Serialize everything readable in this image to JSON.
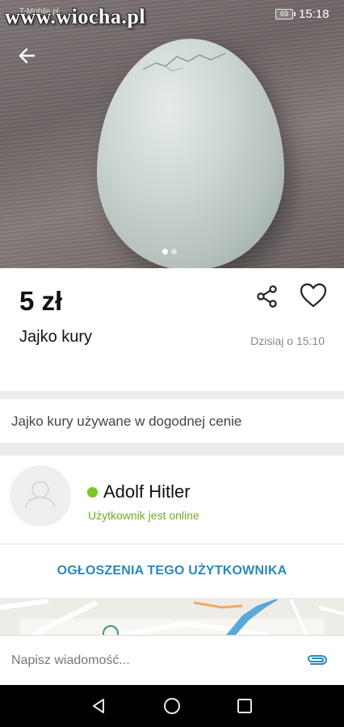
{
  "status_bar": {
    "carrier": "T-Mobile.pl",
    "battery": "69",
    "time": "15:18"
  },
  "watermark": "www.wiocha.pl",
  "gallery": {
    "image_count": 2,
    "active_index": 0
  },
  "listing": {
    "price": "5 zł",
    "title": "Jajko kury",
    "date": "Dzisiaj o 15:10",
    "description": "Jajko kury używane w dogodnej cenie"
  },
  "seller": {
    "name": "Adolf Hitler",
    "status": "Użytkownik jest online",
    "ads_link": "OGŁOSZENIA TEGO UŻYTKOWNIKA"
  },
  "message": {
    "placeholder": "Napisz wiadomość..."
  },
  "icons": {
    "back": "arrow-left-icon",
    "share": "share-icon",
    "favorite": "heart-icon",
    "attach": "paperclip-icon",
    "nav_back": "triangle-back-icon",
    "nav_home": "circle-home-icon",
    "nav_recent": "square-recent-icon"
  },
  "colors": {
    "online": "#7cc623",
    "link": "#2a88bd",
    "status_text": "#6cae1c"
  }
}
